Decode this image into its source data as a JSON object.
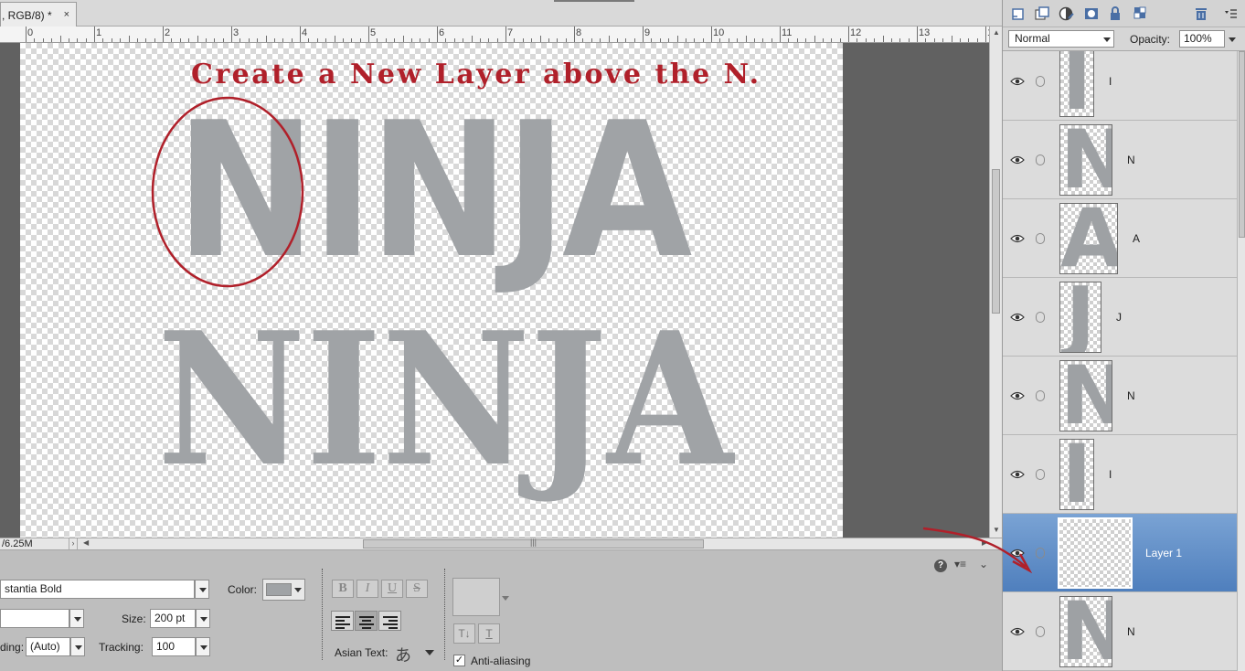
{
  "document": {
    "tab_title": ", RGB/8) *",
    "close_symbol": "×",
    "status": "/6.25M"
  },
  "ruler": {
    "numbers": [
      "0",
      "1",
      "2",
      "3",
      "4",
      "5",
      "6",
      "7",
      "8",
      "9",
      "10",
      "11",
      "12",
      "13",
      "1"
    ]
  },
  "canvas": {
    "instruction": "Create a New Layer above the N.",
    "word_top": "NINJA",
    "word_bottom": "NINJA",
    "instruction_color": "#b0202a",
    "letter_color": "#a0a3a6",
    "circle_color": "#b0202a"
  },
  "options": {
    "font_family_value": "stantia Bold",
    "font_style_value": "",
    "color_label": "Color:",
    "size_label": "Size:",
    "size_value": "200 pt",
    "leading_label": "ding:",
    "leading_value": "(Auto)",
    "tracking_label": "Tracking:",
    "tracking_value": "100",
    "bold": "B",
    "italic": "I",
    "underline": "U",
    "strike": "S",
    "asian_text_label": "Asian Text:",
    "asian_glyph": "あ",
    "anti_alias_label": "Anti-aliasing",
    "anti_alias_checked": "✓",
    "help_icon": "?",
    "warp_a": "T↓",
    "warp_b": "T"
  },
  "layers_panel": {
    "blend_mode": "Normal",
    "opacity_label": "Opacity:",
    "opacity_value": "100%",
    "layers": [
      {
        "name": "I",
        "glyph": "I",
        "selected": false
      },
      {
        "name": "N",
        "glyph": "N",
        "selected": false
      },
      {
        "name": "A",
        "glyph": "A",
        "selected": false
      },
      {
        "name": "J",
        "glyph": "J",
        "selected": false
      },
      {
        "name": "N",
        "glyph": "N",
        "selected": false
      },
      {
        "name": "I",
        "glyph": "I",
        "selected": false
      },
      {
        "name": "Layer 1",
        "glyph": "",
        "selected": true
      },
      {
        "name": "N",
        "glyph": "N",
        "selected": false
      }
    ]
  },
  "annotation_arrow_color": "#b0202a"
}
